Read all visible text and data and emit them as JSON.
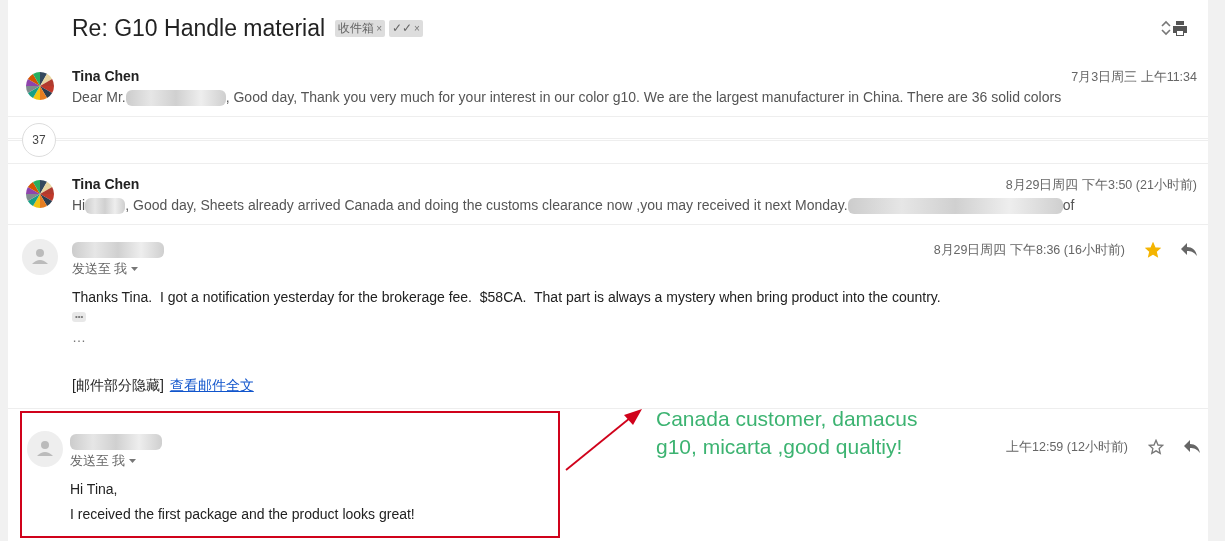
{
  "subject": "Re: G10 Handle material",
  "labels": [
    {
      "text": "收件箱",
      "remove": "×"
    },
    {
      "text": "✓✓",
      "remove": "×"
    }
  ],
  "thread_count": "37",
  "messages": [
    {
      "kind": "collapsed",
      "avatar": {
        "kind": "picture"
      },
      "sender": "Tina Chen",
      "date": "7月3日周三 上午11:34",
      "snippet": [
        {
          "kind": "text",
          "text": "Dear Mr."
        },
        {
          "kind": "redacted"
        },
        {
          "kind": "text",
          "text": ", Good day, Thank you very much for your interest in our color g10. We are the largest manufacturer in China. There are 36 solid colors"
        }
      ]
    },
    {
      "kind": "collapsed",
      "avatar": {
        "kind": "picture"
      },
      "sender": "Tina Chen",
      "date": "8月29日周四 下午3:50 (21小时前)",
      "snippet": [
        {
          "kind": "text",
          "text": "Hi"
        },
        {
          "kind": "redacted"
        },
        {
          "kind": "text",
          "text": ", Good day, Sheets already arrived Canada and doing the customs clearance now ,you may received it next Monday."
        },
        {
          "kind": "redacted"
        },
        {
          "kind": "text",
          "text": "of"
        }
      ]
    },
    {
      "kind": "expanded",
      "avatar": {
        "kind": "person"
      },
      "recipient": "发送至 我",
      "date": "8月29日周四 下午8:36 (16小时前)",
      "starred": true,
      "highlighted": false,
      "body": [
        "Thanks Tina.  I got a notification yesterday for the brokerage fee.  $58CA.  That part is always a mystery when bring product into the country."
      ],
      "show_trimmed": "•••",
      "ellipsis": "…",
      "hidden_note": "[邮件部分隐藏]",
      "full_link": "查看邮件全文"
    },
    {
      "kind": "expanded",
      "avatar": {
        "kind": "person"
      },
      "recipient": "发送至 我",
      "date": "上午12:59 (12小时前)",
      "starred": false,
      "highlighted": true,
      "body": [
        "Hi Tina,",
        "I received the first package and the product looks great!"
      ]
    }
  ],
  "annotation": {
    "text": "Canada customer, damacus g10, micarta ,good qualtiy!"
  }
}
